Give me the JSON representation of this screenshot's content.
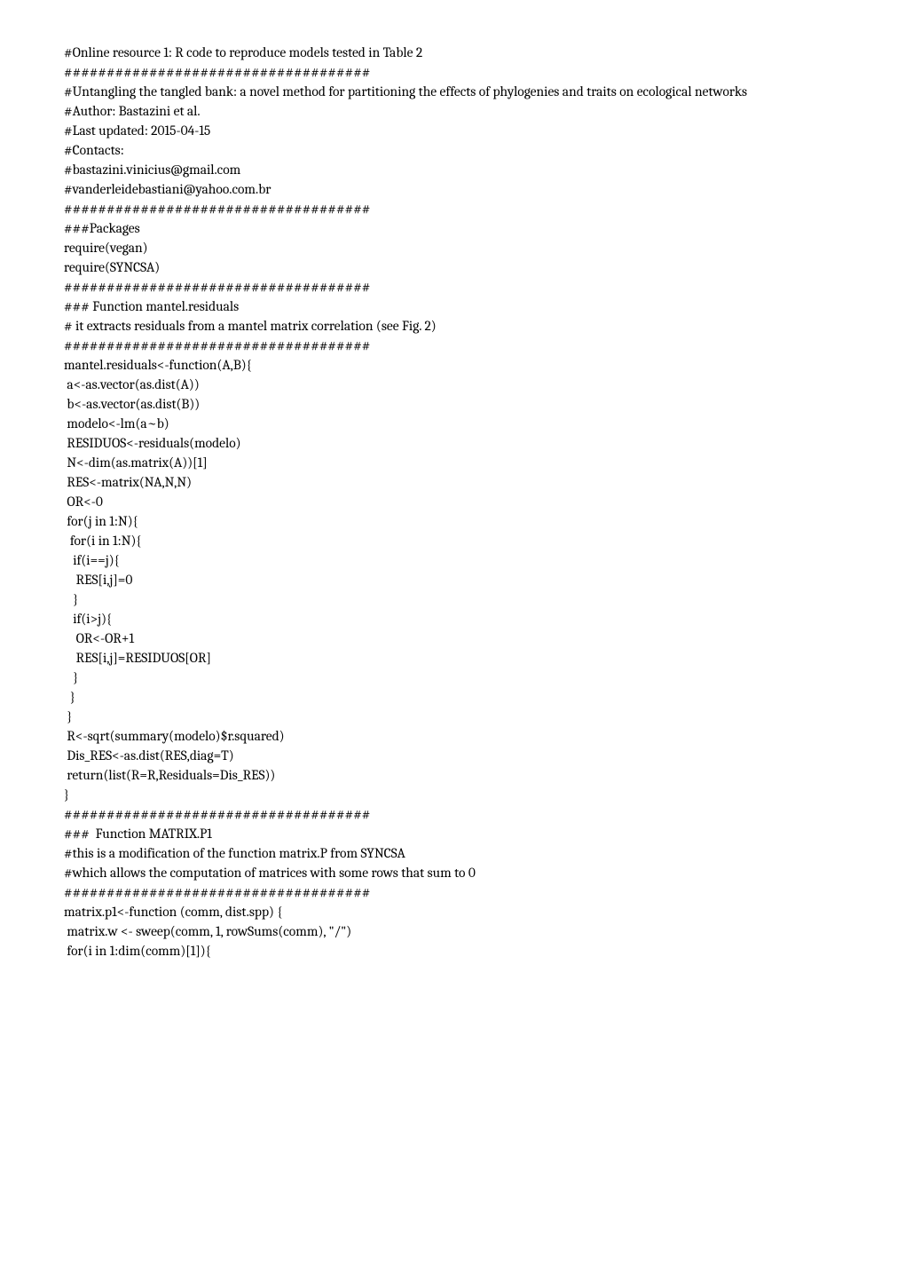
{
  "lines": [
    "#Online resource 1: R code to reproduce models tested in Table 2",
    "",
    "####################################",
    "#Untangling the tangled bank: a novel method for partitioning the effects of phylogenies and traits on ecological networks",
    "#Author: Bastazini et al.",
    "#Last updated: 2015-04-15",
    "#Contacts:",
    "#bastazini.vinicius@gmail.com",
    "#vanderleidebastiani@yahoo.com.br",
    "####################################",
    "###Packages",
    "require(vegan)",
    "require(SYNCSA)",
    "####################################",
    "### Function mantel.residuals",
    "# it extracts residuals from a mantel matrix correlation (see Fig. 2)",
    "####################################",
    "mantel.residuals<-function(A,B){",
    " a<-as.vector(as.dist(A))",
    " b<-as.vector(as.dist(B))",
    " modelo<-lm(a~b)",
    " RESIDUOS<-residuals(modelo)",
    " N<-dim(as.matrix(A))[1]",
    " RES<-matrix(NA,N,N)",
    " OR<-0",
    " for(j in 1:N){",
    "  for(i in 1:N){",
    "   if(i==j){",
    "    RES[i,j]=0",
    "   }",
    "   if(i>j){",
    "    OR<-OR+1",
    "    RES[i,j]=RESIDUOS[OR]",
    "   }",
    "  }",
    " }",
    " R<-sqrt(summary(modelo)$r.squared)",
    " Dis_RES<-as.dist(RES,diag=T)",
    " return(list(R=R,Residuals=Dis_RES))",
    "}",
    "####################################",
    "###  Function MATRIX.P1",
    "#this is a modification of the function matrix.P from SYNCSA",
    "#which allows the computation of matrices with some rows that sum to 0",
    "####################################",
    "matrix.p1<-function (comm, dist.spp) {",
    " matrix.w <- sweep(comm, 1, rowSums(comm), \"/\")",
    " for(i in 1:dim(comm)[1]){"
  ]
}
